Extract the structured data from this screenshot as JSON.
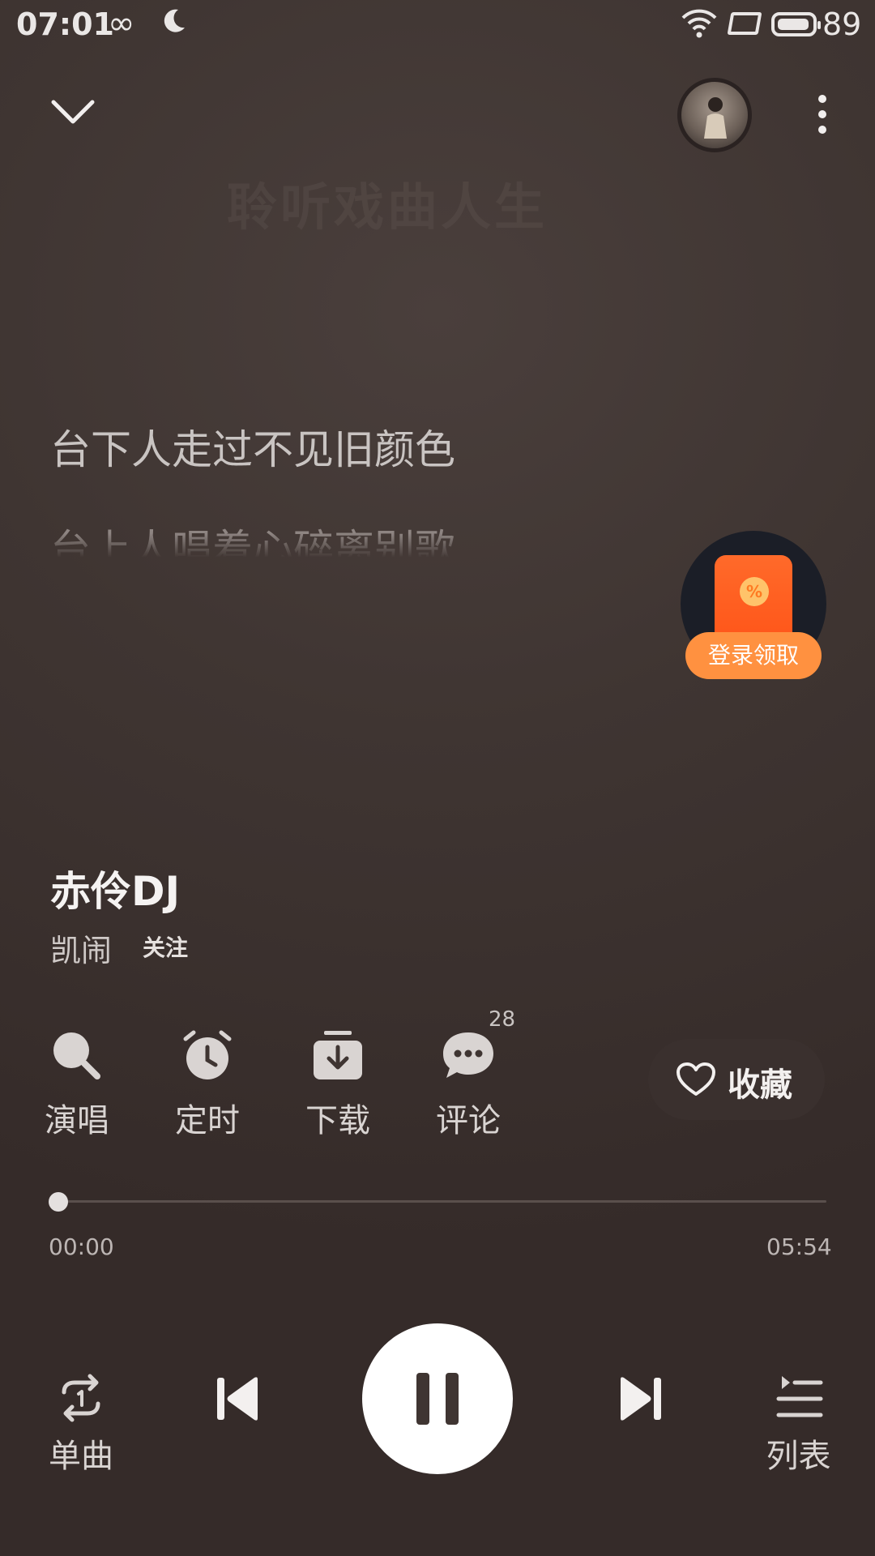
{
  "status_bar": {
    "time": "07:01",
    "infinity_glyph": "∞",
    "battery": "89",
    "icons": [
      "moon-icon",
      "wifi-icon",
      "screen-icon",
      "battery-icon"
    ]
  },
  "player": {
    "background_title": "聆听戏曲人生",
    "lyrics": [
      "台下人走过不见旧颜色",
      "台上人唱着心碎离别歌"
    ],
    "song_title": "赤伶DJ",
    "artist": "凯闹",
    "follow_label": "关注",
    "red_packet_label": "登录领取",
    "actions": [
      {
        "label": "演唱",
        "icon": "sing-icon"
      },
      {
        "label": "定时",
        "icon": "alarm-icon"
      },
      {
        "label": "下载",
        "icon": "download-icon"
      },
      {
        "label": "评论",
        "icon": "comment-icon"
      }
    ],
    "comment_count": "28",
    "favorite_label": "收藏",
    "progress": {
      "current": "00:00",
      "total": "05:54",
      "fraction": 0.0
    },
    "controls": {
      "mode_label": "单曲",
      "playlist_label": "列表"
    }
  },
  "colors": {
    "accent_orange": "#ff9140",
    "background": "#3f3532"
  }
}
